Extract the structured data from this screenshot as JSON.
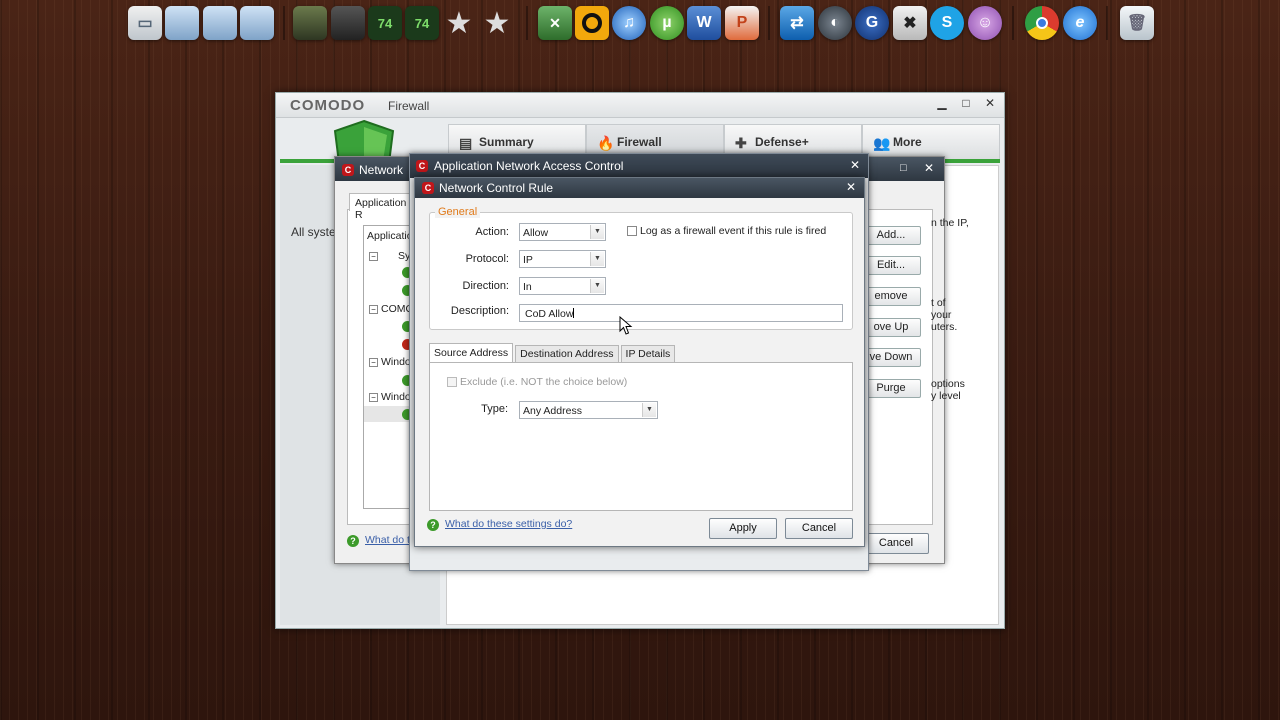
{
  "comodo": {
    "brand": "COMODO",
    "product": "Firewall",
    "tabs": [
      "Summary",
      "Firewall",
      "Defense+",
      "More"
    ],
    "bg_text": "All syste"
  },
  "network_window": {
    "title": "Network",
    "tab_label": "Application R",
    "column_header": "Applicatio",
    "tree_items": [
      "Sy",
      "COMO",
      "Windo",
      "Windo"
    ],
    "right_buttons": [
      "Add...",
      "Edit...",
      "emove",
      "ove Up",
      "ve Down",
      "Purge"
    ],
    "right_text_1": "n the IP,",
    "right_text_2": "t of\nyour\nuters.",
    "right_text_3": "options\ny level",
    "help_link": "What do t",
    "cancel_label": "Cancel"
  },
  "anac": {
    "title": "Application Network Access Control"
  },
  "dialog": {
    "title": "Network Control Rule",
    "general_label": "General",
    "action_label": "Action:",
    "action_value": "Allow",
    "protocol_label": "Protocol:",
    "protocol_value": "IP",
    "direction_label": "Direction:",
    "direction_value": "In",
    "description_label": "Description:",
    "description_value": "CoD Allow",
    "log_label": "Log as a firewall event if this rule is fired",
    "tabs": [
      "Source Address",
      "Destination Address",
      "IP Details"
    ],
    "exclude_label": "Exclude (i.e. NOT the choice below)",
    "type_label": "Type:",
    "type_value": "Any Address",
    "help_link": "What do these settings do?",
    "apply_label": "Apply",
    "cancel_label": "Cancel"
  },
  "dock": {
    "icons": [
      "computer-icon",
      "folder-icon",
      "folder-icon",
      "folder-icon",
      "halo-icon",
      "soldier-icon",
      "rank-icon",
      "rank-icon",
      "star-icon",
      "star-icon",
      "excel-icon",
      "circle-icon",
      "itunes-icon",
      "utorrent-icon",
      "word-icon",
      "powerpoint-icon",
      "teamviewer-icon",
      "steam-icon",
      "gamespy-icon",
      "xfire-icon",
      "skype-icon",
      "messenger-icon",
      "chrome-icon",
      "ie-icon",
      "recycle-bin-icon"
    ]
  },
  "colors": {
    "accent_green": "#3aa23a",
    "title_dark": "#2e3741",
    "group_orange": "#e07a1a",
    "link_blue": "#3a5fa8",
    "comodo_red": "#c0161a"
  }
}
